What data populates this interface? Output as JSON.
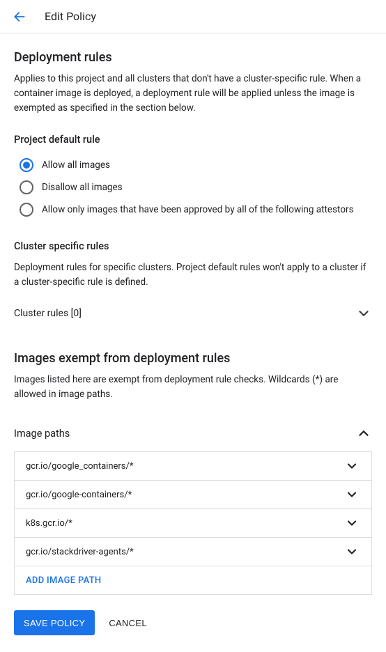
{
  "header": {
    "title": "Edit Policy"
  },
  "deployment_rules": {
    "title": "Deployment rules",
    "desc": "Applies to this project and all clusters that don't have a cluster-specific rule. When a container image is deployed, a deployment rule will be applied unless the image is exempted as specified in the section below."
  },
  "project_default": {
    "title": "Project default rule",
    "options": [
      {
        "label": "Allow all images",
        "selected": true
      },
      {
        "label": "Disallow all images",
        "selected": false
      },
      {
        "label": "Allow only images that have been approved by all of the following attestors",
        "selected": false
      }
    ]
  },
  "cluster_specific": {
    "title": "Cluster specific rules",
    "desc": "Deployment rules for specific clusters. Project default rules won't apply to a cluster if a cluster-specific rule is defined.",
    "expander_label": "Cluster rules [0]"
  },
  "exempt": {
    "title": "Images exempt from deployment rules",
    "desc": "Images listed here are exempt from deployment rule checks. Wildcards (*) are allowed in image paths.",
    "paths_label": "Image paths",
    "paths": [
      "gcr.io/google_containers/*",
      "gcr.io/google-containers/*",
      "k8s.gcr.io/*",
      "gcr.io/stackdriver-agents/*"
    ],
    "add_label": "ADD IMAGE PATH"
  },
  "actions": {
    "save": "SAVE POLICY",
    "cancel": "CANCEL"
  }
}
